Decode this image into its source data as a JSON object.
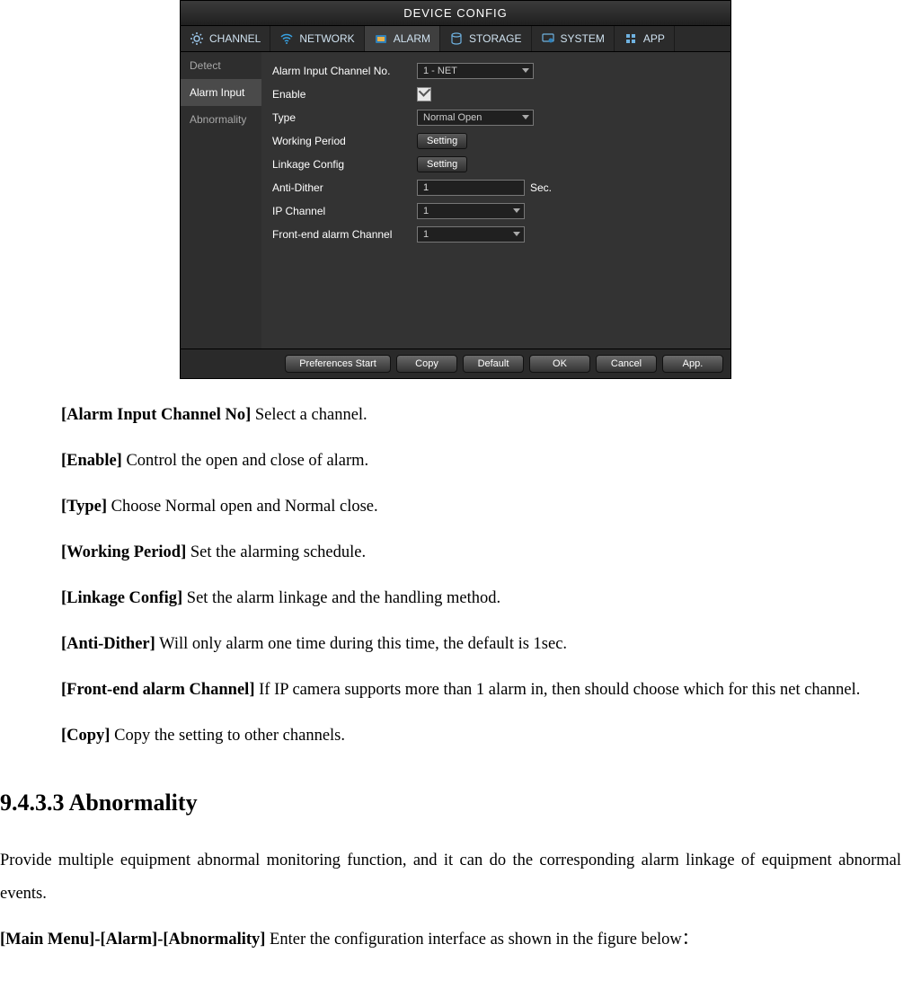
{
  "window": {
    "title": "DEVICE CONFIG",
    "tabs": [
      "CHANNEL",
      "NETWORK",
      "ALARM",
      "STORAGE",
      "SYSTEM",
      "APP"
    ],
    "active_tab": "ALARM",
    "sidebar": [
      "Detect",
      "Alarm Input",
      "Abnormality"
    ],
    "active_side": "Alarm Input",
    "form": {
      "alarm_channel_label": "Alarm Input Channel No.",
      "alarm_channel_value": "1 - NET",
      "enable_label": "Enable",
      "enable_checked": true,
      "type_label": "Type",
      "type_value": "Normal Open",
      "working_period_label": "Working Period",
      "working_period_btn": "Setting",
      "linkage_label": "Linkage Config",
      "linkage_btn": "Setting",
      "anti_dither_label": "Anti-Dither",
      "anti_dither_value": "1",
      "anti_dither_unit": "Sec.",
      "ip_channel_label": "IP Channel",
      "ip_channel_value": "1",
      "front_end_label": "Front-end alarm Channel",
      "front_end_value": "1"
    },
    "footer": [
      "Preferences Start",
      "Copy",
      "Default",
      "OK",
      "Cancel",
      "App."
    ]
  },
  "doc": {
    "items": [
      {
        "term": "[Alarm Input Channel No]",
        "desc": " Select a channel."
      },
      {
        "term": "[Enable]",
        "desc": " Control the open and close of alarm."
      },
      {
        "term": "[Type]",
        "desc": " Choose Normal open and Normal close."
      },
      {
        "term": "[Working Period]",
        "desc": " Set the alarming schedule."
      },
      {
        "term": "[Linkage Config]",
        "desc": " Set the alarm linkage and the handling method."
      },
      {
        "term": "[Anti-Dither]",
        "desc": " Will only alarm one time during this time, the default is 1sec."
      },
      {
        "term": "[Front-end alarm Channel]",
        "desc": " If IP camera supports more than 1 alarm in, then should choose which for this net channel."
      },
      {
        "term": "[Copy]",
        "desc": " Copy the setting to other channels."
      }
    ],
    "section_heading": "9.4.3.3 Abnormality",
    "section_para": "Provide multiple equipment abnormal monitoring function, and it can do the corresponding alarm linkage of equipment abnormal events.",
    "nav_bold": "[Main Menu]-[Alarm]-[Abnormality]",
    "nav_rest": " Enter the configuration interface as shown in the figure below："
  }
}
